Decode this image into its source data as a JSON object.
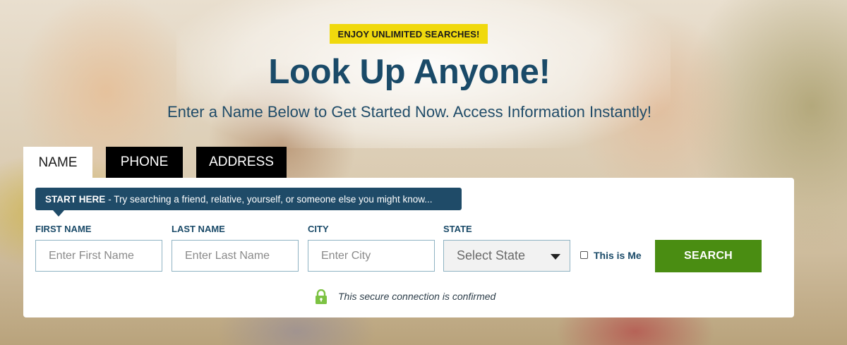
{
  "hero": {
    "badge": "ENJOY UNLIMITED SEARCHES!",
    "headline": "Look Up Anyone!",
    "subhead": "Enter a Name Below to Get Started Now. Access Information Instantly!"
  },
  "tabs": [
    {
      "label": "NAME",
      "active": true
    },
    {
      "label": "PHONE",
      "active": false
    },
    {
      "label": "ADDRESS",
      "active": false
    }
  ],
  "tooltip": {
    "strong": "START HERE",
    "text": "- Try searching a friend, relative, yourself, or someone else you might know..."
  },
  "form": {
    "first_name": {
      "label": "FIRST NAME",
      "placeholder": "Enter First Name"
    },
    "last_name": {
      "label": "LAST NAME",
      "placeholder": "Enter Last Name"
    },
    "city": {
      "label": "CITY",
      "placeholder": "Enter City"
    },
    "state": {
      "label": "STATE",
      "value": "Select State"
    },
    "this_is_me": {
      "label": "This is Me",
      "checked": false
    },
    "search_label": "SEARCH"
  },
  "security": {
    "text": "This secure connection is confirmed",
    "icon": "lock-icon"
  },
  "colors": {
    "navy": "#1a4a68",
    "badge_yellow": "#f0d90d",
    "search_green": "#4a8d12",
    "lock_green": "#7cc242"
  }
}
